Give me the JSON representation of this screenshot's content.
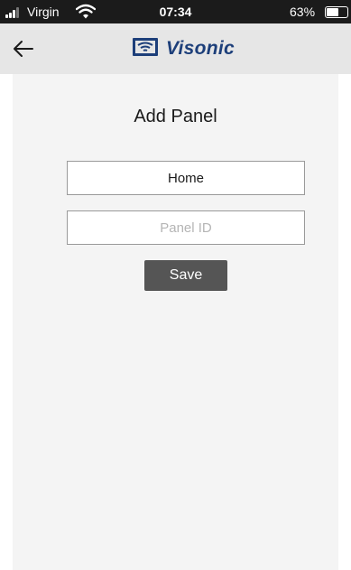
{
  "status_bar": {
    "carrier": "Virgin",
    "time": "07:34",
    "battery_percent": "63%",
    "battery_level": 0.63,
    "signal_icon": "signal-bars-icon",
    "wifi_icon": "wifi-icon",
    "battery_icon": "battery-icon"
  },
  "nav": {
    "back_icon": "arrow-left-icon",
    "logo_icon": "visonic-logo-icon",
    "brand": "Visonic",
    "brand_color": "#1d3f7a"
  },
  "form": {
    "title": "Add Panel",
    "name_value": "Home",
    "panel_id_placeholder": "Panel ID",
    "save_label": "Save"
  }
}
